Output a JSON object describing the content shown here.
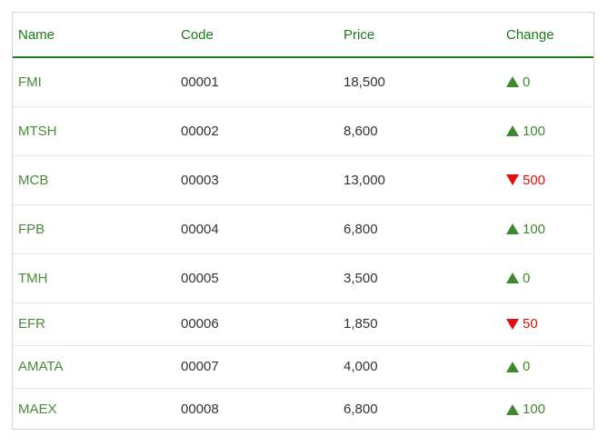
{
  "table": {
    "headers": [
      "Name",
      "Code",
      "Price",
      "Change"
    ],
    "rows": [
      {
        "name": "FMI",
        "code": "00001",
        "price": "18,500",
        "direction": "up",
        "change": "0"
      },
      {
        "name": "MTSH",
        "code": "00002",
        "price": "8,600",
        "direction": "up",
        "change": "100"
      },
      {
        "name": "MCB",
        "code": "00003",
        "price": "13,000",
        "direction": "down",
        "change": "500"
      },
      {
        "name": "FPB",
        "code": "00004",
        "price": "6,800",
        "direction": "up",
        "change": "100"
      },
      {
        "name": "TMH",
        "code": "00005",
        "price": "3,500",
        "direction": "up",
        "change": "0"
      },
      {
        "name": "EFR",
        "code": "00006",
        "price": "1,850",
        "direction": "down",
        "change": "50"
      },
      {
        "name": "AMATA",
        "code": "00007",
        "price": "4,000",
        "direction": "up",
        "change": "0"
      },
      {
        "name": "MAEX",
        "code": "00008",
        "price": "6,800",
        "direction": "up",
        "change": "100"
      }
    ]
  },
  "icons": {
    "up": "triangle-up-icon",
    "down": "triangle-down-icon"
  },
  "colors": {
    "header": "#1a7a1a",
    "name": "#4a8a3a",
    "up": "#3d8a2e",
    "down": "#e01010"
  }
}
